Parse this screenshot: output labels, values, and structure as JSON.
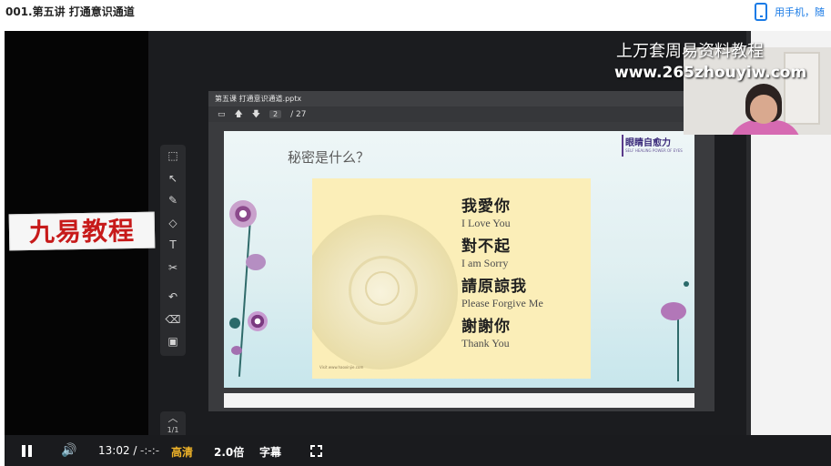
{
  "header": {
    "title": "001.第五讲 打通意识通道",
    "mobile_text": "用手机，随"
  },
  "video": {
    "watermark": "九易教程",
    "overlay_line1": "上万套周易资料教程",
    "overlay_line2": "www.265zhouyiw.com",
    "ppt": {
      "filename": "第五课 打通意识通道.pptx",
      "minimize": "–",
      "page_current": "2",
      "page_total": "/ 27",
      "slide": {
        "title": "秘密是什么？",
        "logo_main": "眼睛自愈力",
        "logo_sub": "SELF HEALING POWER OF EYES",
        "phrases": [
          {
            "zh": "我愛你",
            "en": "I Love You"
          },
          {
            "zh": "對不起",
            "en": "I am Sorry"
          },
          {
            "zh": "請原諒我",
            "en": "Please Forgive Me"
          },
          {
            "zh": "謝謝你",
            "en": "Thank You"
          }
        ],
        "card_note": "Visit www.haoxinjie.com"
      }
    },
    "toolbar": {
      "icons": [
        "select-laser-icon",
        "pointer-icon",
        "pen-icon",
        "shapes-icon",
        "text-icon",
        "cut-icon",
        "undo-icon",
        "eraser-icon",
        "toolbox-icon"
      ]
    },
    "page_indicator": "1/1"
  },
  "controls": {
    "time_current": "13:02",
    "time_separator": "/",
    "time_total": "-:-:-",
    "quality": "高清",
    "speed": "2.0倍",
    "subtitles": "字幕"
  },
  "colors": {
    "accent_blue": "#1a7be6",
    "quality_gold": "#f0b429",
    "watermark_red": "#c71a1a"
  }
}
